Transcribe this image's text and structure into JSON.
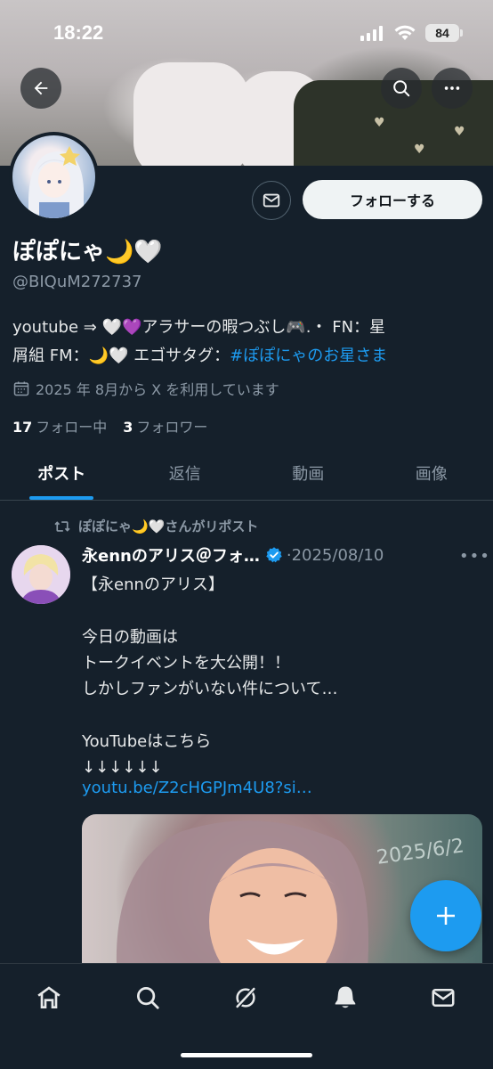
{
  "status_bar": {
    "time": "18:22",
    "battery": "84"
  },
  "header": {
    "back_icon": "arrow-left-icon",
    "search_icon": "search-icon",
    "more_icon": "more-horizontal-icon"
  },
  "profile": {
    "name": "ぽぽにゃ🌙🤍",
    "handle": "@BIQuM272737",
    "bio_line1": "youtube ⇒ 🤍💜アラサーの暇つぶし🎮.・ FN：星",
    "bio_line2_prefix": "屑組 FM：🌙🤍 エゴサタグ：",
    "bio_hashtag": "#ぽぽにゃのお星さま",
    "joined": "2025 年 8月から X を利用しています",
    "following_count": "17",
    "following_label": "フォロー中",
    "followers_count": "3",
    "followers_label": "フォロワー",
    "follow_button": "フォローする"
  },
  "tabs": [
    {
      "label": "ポスト",
      "active": true
    },
    {
      "label": "返信",
      "active": false
    },
    {
      "label": "動画",
      "active": false
    },
    {
      "label": "画像",
      "active": false
    }
  ],
  "post": {
    "repost_label": "ぽぽにゃ🌙🤍さんがリポスト",
    "author": "永ennのアリス＠フォ…",
    "date": "·2025/08/10",
    "text": "【永ennのアリス】\n\n今日の動画は\nトークイベントを大公開！！\nしかしファンがいない件について…\n\nYouTubeはこちら\n↓↓↓↓↓↓",
    "link": "youtu.be/Z2cHGPJm4U8?si…",
    "media_text": "2025/6/2"
  },
  "colors": {
    "accent": "#1d9bf0",
    "background": "#15202b",
    "text": "#e7e9ea",
    "muted": "#8b98a5"
  },
  "bottom_nav": [
    "home-icon",
    "search-icon",
    "grok-icon",
    "notifications-bell-icon",
    "messages-mail-icon"
  ]
}
